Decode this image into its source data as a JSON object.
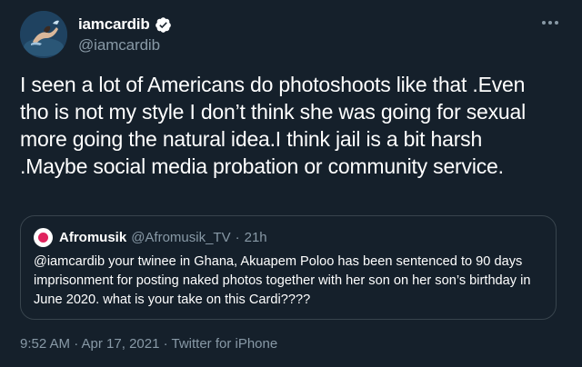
{
  "author": {
    "display_name": "iamcardib",
    "handle": "@iamcardib",
    "verified": true
  },
  "tweet": {
    "text": "I seen a lot of Americans do photoshoots like that .Even tho is not my style I don’t think she was going for sexual more going the natural idea.I think jail is a bit harsh .Maybe social media probation or community service."
  },
  "quoted_tweet": {
    "display_name": "Afromusik",
    "handle": "@Afromusik_TV",
    "time": "21h",
    "separator": "·",
    "text": "@iamcardib your twinee in Ghana, Akuapem Poloo has been sentenced to 90 days imprisonment for posting naked photos together with her son on her son’s birthday in June 2020.  what is your take on this Cardi????"
  },
  "meta": {
    "timestamp_line": "9:52 AM · Apr 17, 2021 · Twitter for iPhone"
  },
  "colors": {
    "background": "#15202b",
    "secondary_text": "#8899a6",
    "border": "#38444d",
    "verified": "#ffffff"
  },
  "icons": {
    "verified": "verified-badge-icon",
    "more": "more-options-icon"
  }
}
